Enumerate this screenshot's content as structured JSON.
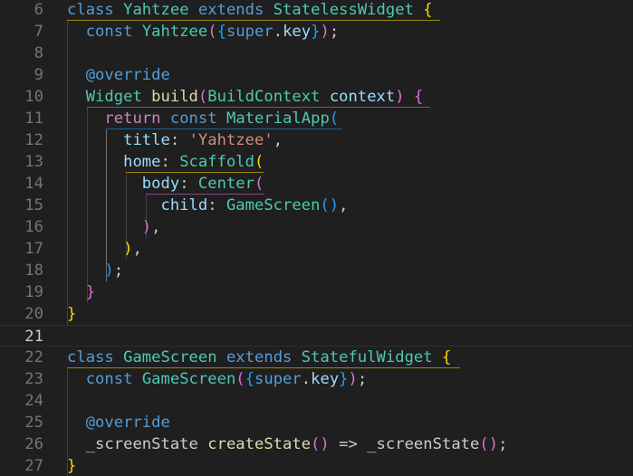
{
  "theme": {
    "background": "#1f1f1f",
    "line_number": "#6e7681",
    "line_number_active": "#cccccc",
    "keyword": "#569cd6",
    "control_keyword": "#c586c0",
    "type": "#4ec9b0",
    "function": "#dcdcaa",
    "variable": "#9cdcfe",
    "string": "#ce9178",
    "plain": "#cccccc",
    "bracket_gold": "#ffd700",
    "bracket_pink": "#da70d6",
    "bracket_blue": "#179fff"
  },
  "editor": {
    "current_line": "21",
    "lines": [
      {
        "num": "6",
        "tokens": [
          [
            "class",
            "kw"
          ],
          [
            " ",
            "p"
          ],
          [
            "Yahtzee",
            "ty"
          ],
          [
            " ",
            "p"
          ],
          [
            "extends",
            "kw"
          ],
          [
            " ",
            "p"
          ],
          [
            "StatelessWidget",
            "ty"
          ],
          [
            " ",
            "p"
          ],
          [
            "{",
            "b1"
          ]
        ]
      },
      {
        "num": "7",
        "tokens": [
          [
            "  ",
            "p"
          ],
          [
            "const",
            "kw"
          ],
          [
            " ",
            "p"
          ],
          [
            "Yahtzee",
            "ty"
          ],
          [
            "(",
            "b2"
          ],
          [
            "{",
            "b3"
          ],
          [
            "super",
            "kw"
          ],
          [
            ".",
            "p"
          ],
          [
            "key",
            "va"
          ],
          [
            "}",
            "b3"
          ],
          [
            ")",
            "b2"
          ],
          [
            ";",
            "p"
          ]
        ]
      },
      {
        "num": "8",
        "tokens": []
      },
      {
        "num": "9",
        "tokens": [
          [
            "  ",
            "p"
          ],
          [
            "@override",
            "kw"
          ]
        ]
      },
      {
        "num": "10",
        "tokens": [
          [
            "  ",
            "p"
          ],
          [
            "Widget",
            "ty"
          ],
          [
            " ",
            "p"
          ],
          [
            "build",
            "fn"
          ],
          [
            "(",
            "b2"
          ],
          [
            "BuildContext",
            "ty"
          ],
          [
            " ",
            "p"
          ],
          [
            "context",
            "va"
          ],
          [
            ")",
            "b2"
          ],
          [
            " ",
            "p"
          ],
          [
            "{",
            "b2"
          ]
        ]
      },
      {
        "num": "11",
        "tokens": [
          [
            "    ",
            "p"
          ],
          [
            "return",
            "ck"
          ],
          [
            " ",
            "p"
          ],
          [
            "const",
            "kw"
          ],
          [
            " ",
            "p"
          ],
          [
            "MaterialApp",
            "ty"
          ],
          [
            "(",
            "b3"
          ]
        ]
      },
      {
        "num": "12",
        "tokens": [
          [
            "      ",
            "p"
          ],
          [
            "title",
            "va"
          ],
          [
            ": ",
            "p"
          ],
          [
            "'Yahtzee'",
            "st"
          ],
          [
            ",",
            "p"
          ]
        ]
      },
      {
        "num": "13",
        "tokens": [
          [
            "      ",
            "p"
          ],
          [
            "home",
            "va"
          ],
          [
            ": ",
            "p"
          ],
          [
            "Scaffold",
            "ty"
          ],
          [
            "(",
            "b1"
          ]
        ]
      },
      {
        "num": "14",
        "tokens": [
          [
            "        ",
            "p"
          ],
          [
            "body",
            "va"
          ],
          [
            ": ",
            "p"
          ],
          [
            "Center",
            "ty"
          ],
          [
            "(",
            "b2"
          ]
        ]
      },
      {
        "num": "15",
        "tokens": [
          [
            "          ",
            "p"
          ],
          [
            "child",
            "va"
          ],
          [
            ": ",
            "p"
          ],
          [
            "GameScreen",
            "ty"
          ],
          [
            "()",
            "b3"
          ],
          [
            ",",
            "p"
          ]
        ]
      },
      {
        "num": "16",
        "tokens": [
          [
            "        ",
            "p"
          ],
          [
            ")",
            "b2"
          ],
          [
            ",",
            "p"
          ]
        ]
      },
      {
        "num": "17",
        "tokens": [
          [
            "      ",
            "p"
          ],
          [
            ")",
            "b1"
          ],
          [
            ",",
            "p"
          ]
        ]
      },
      {
        "num": "18",
        "tokens": [
          [
            "    ",
            "p"
          ],
          [
            ")",
            "b3"
          ],
          [
            ";",
            "p"
          ]
        ]
      },
      {
        "num": "19",
        "tokens": [
          [
            "  ",
            "p"
          ],
          [
            "}",
            "b2"
          ]
        ]
      },
      {
        "num": "20",
        "tokens": [
          [
            "}",
            "b1"
          ]
        ]
      },
      {
        "num": "21",
        "tokens": []
      },
      {
        "num": "22",
        "tokens": [
          [
            "class",
            "kw"
          ],
          [
            " ",
            "p"
          ],
          [
            "GameScreen",
            "ty"
          ],
          [
            " ",
            "p"
          ],
          [
            "extends",
            "kw"
          ],
          [
            " ",
            "p"
          ],
          [
            "StatefulWidget",
            "ty"
          ],
          [
            " ",
            "p"
          ],
          [
            "{",
            "b1"
          ]
        ]
      },
      {
        "num": "23",
        "tokens": [
          [
            "  ",
            "p"
          ],
          [
            "const",
            "kw"
          ],
          [
            " ",
            "p"
          ],
          [
            "GameScreen",
            "ty"
          ],
          [
            "(",
            "b2"
          ],
          [
            "{",
            "b3"
          ],
          [
            "super",
            "kw"
          ],
          [
            ".",
            "p"
          ],
          [
            "key",
            "va"
          ],
          [
            "}",
            "b3"
          ],
          [
            ")",
            "b2"
          ],
          [
            ";",
            "p"
          ]
        ]
      },
      {
        "num": "24",
        "tokens": []
      },
      {
        "num": "25",
        "tokens": [
          [
            "  ",
            "p"
          ],
          [
            "@override",
            "kw"
          ]
        ]
      },
      {
        "num": "26",
        "tokens": [
          [
            "  ",
            "p"
          ],
          [
            "_screenState",
            "p"
          ],
          [
            " ",
            "p"
          ],
          [
            "createState",
            "fn"
          ],
          [
            "()",
            "b2"
          ],
          [
            " => ",
            "p"
          ],
          [
            "_screenState",
            "p"
          ],
          [
            "()",
            "b2"
          ],
          [
            ";",
            "p"
          ]
        ]
      },
      {
        "num": "27",
        "tokens": [
          [
            "}",
            "b1"
          ]
        ]
      }
    ]
  }
}
